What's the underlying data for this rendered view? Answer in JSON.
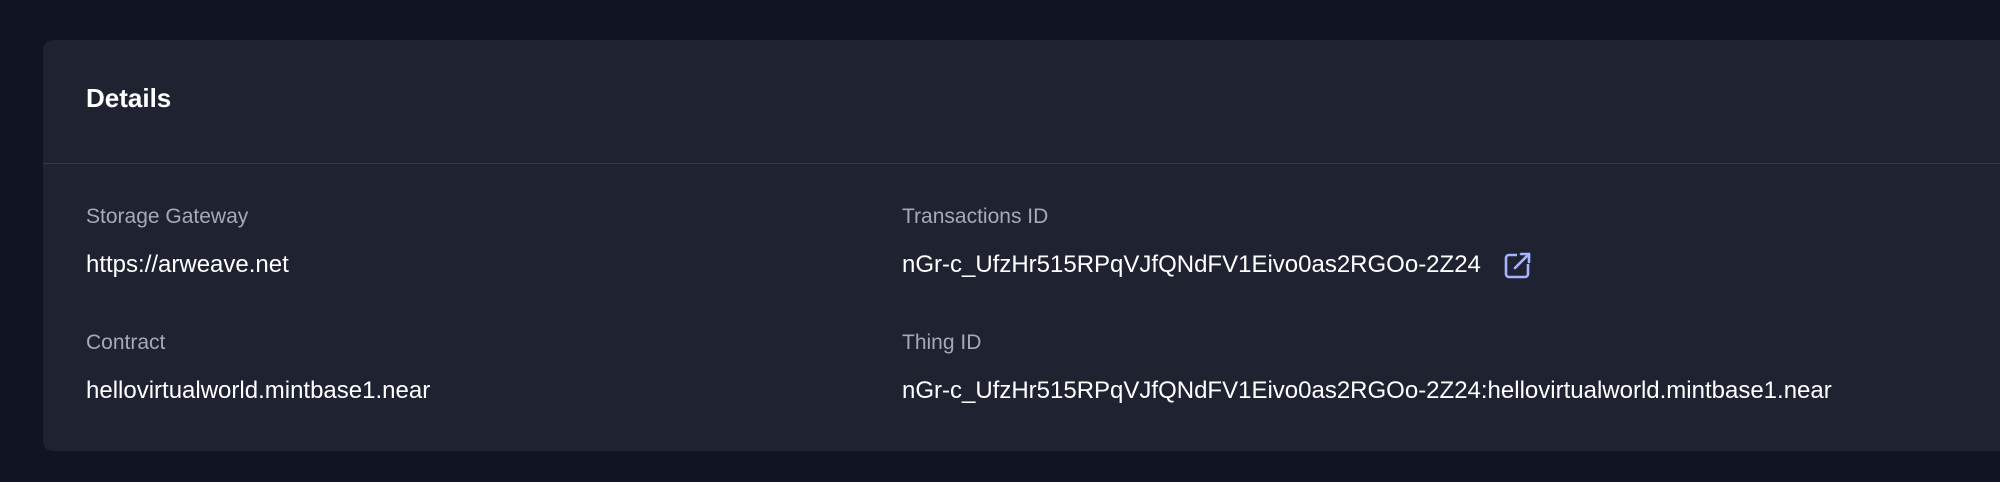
{
  "details": {
    "title": "Details",
    "storage_gateway": {
      "label": "Storage Gateway",
      "value": "https://arweave.net"
    },
    "transactions_id": {
      "label": "Transactions ID",
      "value": "nGr-c_UfzHr515RPqVJfQNdFV1Eivo0as2RGOo-2Z24",
      "link_icon": "external-link-icon"
    },
    "contract": {
      "label": "Contract",
      "value": "hellovirtualworld.mintbase1.near"
    },
    "thing_id": {
      "label": "Thing ID",
      "value": "nGr-c_UfzHr515RPqVJfQNdFV1Eivo0as2RGOo-2Z24:hellovirtualworld.mintbase1.near"
    }
  },
  "colors": {
    "background": "#111422",
    "card": "#1f2231",
    "label": "#a6a9b6",
    "value": "#ffffff",
    "accent_icon": "#a9b4ff"
  }
}
